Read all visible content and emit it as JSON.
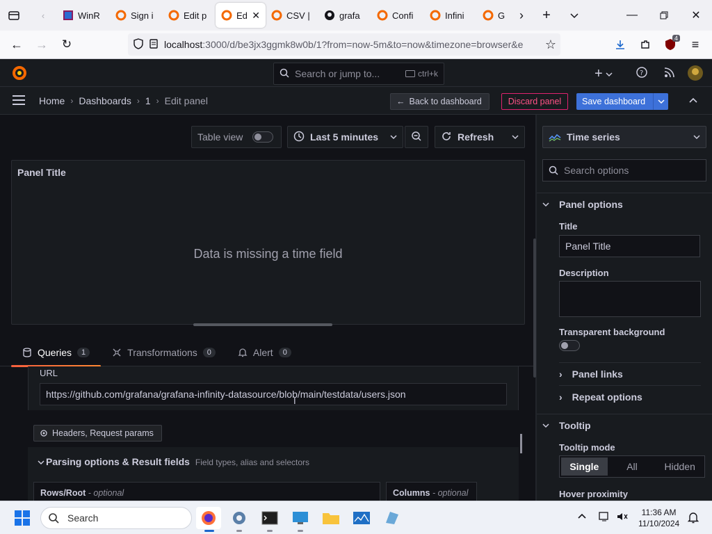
{
  "browser": {
    "tabs": [
      {
        "label": "WinR",
        "icon": "winrar-icon"
      },
      {
        "label": "Sign i",
        "icon": "grafana-icon"
      },
      {
        "label": "Edit p",
        "icon": "grafana-icon"
      },
      {
        "label": "Edi",
        "icon": "grafana-icon",
        "active": true
      },
      {
        "label": "CSV |",
        "icon": "grafana-icon"
      },
      {
        "label": "grafa",
        "icon": "github-icon"
      },
      {
        "label": "Confi",
        "icon": "grafana-icon"
      },
      {
        "label": "Infini",
        "icon": "grafana-icon"
      },
      {
        "label": "Get",
        "icon": "grafana-icon"
      }
    ],
    "url_host": "localhost",
    "url_rest": ":3000/d/be3jx3ggmk8w0b/1?from=now-5m&to=now&timezone=browser&e",
    "extension_badge": "4"
  },
  "grafana": {
    "search_placeholder": "Search or jump to...",
    "search_shortcut": "ctrl+k",
    "breadcrumbs": [
      "Home",
      "Dashboards",
      "1",
      "Edit panel"
    ],
    "back_label": "Back to dashboard",
    "discard_label": "Discard panel",
    "save_label": "Save dashboard",
    "table_view_label": "Table view",
    "time_range": "Last 5 minutes",
    "refresh_label": "Refresh",
    "panel_title": "Panel Title",
    "panel_message": "Data is missing a time field",
    "tabs": [
      {
        "label": "Queries",
        "count": "1"
      },
      {
        "label": "Transformations",
        "count": "0"
      },
      {
        "label": "Alert",
        "count": "0"
      }
    ],
    "url_field_label": "URL",
    "url_value": "https://github.com/grafana/grafana-infinity-datasource/blob/main/testdata/users.json",
    "headers_label": "Headers, Request params",
    "parsing_title": "Parsing options & Result fields",
    "parsing_subtitle": "Field types, alias and selectors",
    "rows_root_label": "Rows/Root",
    "rows_root_hint": "- optional",
    "columns_label": "Columns",
    "columns_hint": "- optional"
  },
  "options": {
    "viz": "Time series",
    "search_placeholder": "Search options",
    "panel_options": "Panel options",
    "title_label": "Title",
    "title_value": "Panel Title",
    "description_label": "Description",
    "transparent_label": "Transparent background",
    "panel_links": "Panel links",
    "repeat_options": "Repeat options",
    "tooltip": "Tooltip",
    "tooltip_mode_label": "Tooltip mode",
    "tooltip_modes": [
      "Single",
      "All",
      "Hidden"
    ],
    "hover_proximity": "Hover proximity"
  },
  "taskbar": {
    "search_label": "Search",
    "time": "11:36 AM",
    "date": "11/10/2024"
  }
}
